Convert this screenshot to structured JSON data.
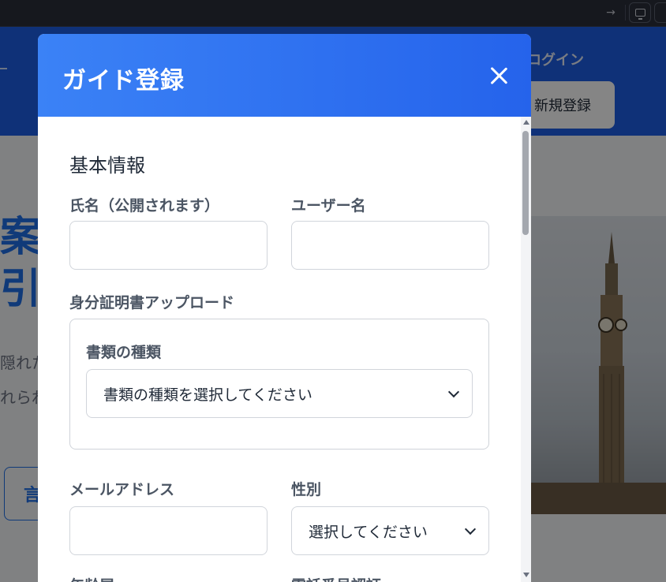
{
  "browser": {
    "forward_icon": "arrow-right-icon",
    "display_icon": "monitor-icon"
  },
  "site": {
    "header": {
      "login": "ログイン",
      "signup": "新規登録"
    },
    "hero": {
      "line1": "案[",
      "line2": "引7",
      "sub1": "隠れた",
      "sub2": "れられ",
      "button": "言"
    }
  },
  "modal": {
    "title": "ガイド登録",
    "close_icon": "close-icon",
    "section_basic": "基本情報",
    "fields": {
      "name_label": "氏名（公開されます）",
      "name_value": "",
      "username_label": "ユーザー名",
      "username_value": "",
      "id_upload_label": "身分証明書アップロード",
      "doc_type_label": "書類の種類",
      "doc_type_selected": "書類の種類を選択してください",
      "email_label": "メールアドレス",
      "email_value": "",
      "gender_label": "性別",
      "gender_selected": "選択してください",
      "age_label": "年齢層",
      "phone_verify_label": "電話番号認証"
    }
  }
}
